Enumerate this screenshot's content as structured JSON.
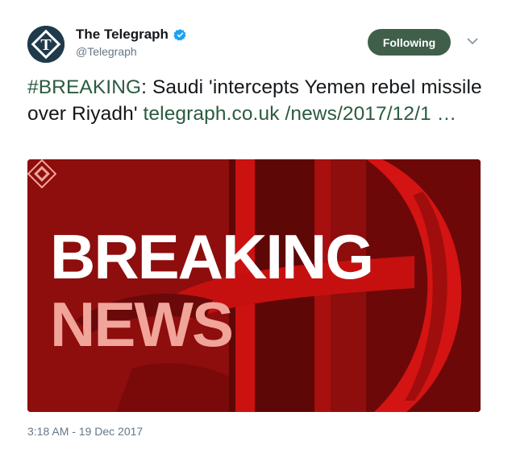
{
  "account": {
    "display_name": "The Telegraph",
    "handle": "@Telegraph",
    "avatar_letter": "T",
    "verified": true
  },
  "follow_button": {
    "label": "Following"
  },
  "tweet": {
    "hashtag": "#BREAKING",
    "text": ": Saudi 'intercepts Yemen rebel missile over Riyadh' ",
    "link": "telegraph.co.uk /news/2017/12/1 …"
  },
  "card": {
    "headline_1": "BREAKING",
    "headline_2": "NEWS"
  },
  "timestamp": "3:18 AM - 19 Dec 2017",
  "colors": {
    "card_base": "#8e0d0d",
    "card_red": "#cc1111",
    "news_text": "#f0a49a",
    "following_button": "#3f5f4a"
  }
}
